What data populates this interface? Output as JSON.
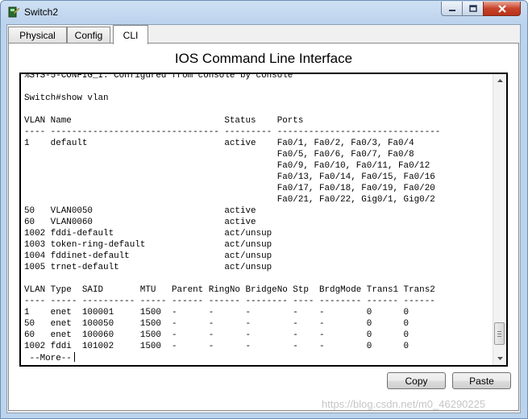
{
  "window": {
    "title": "Switch2"
  },
  "tabs": [
    {
      "label": "Physical"
    },
    {
      "label": "Config"
    },
    {
      "label": "CLI"
    }
  ],
  "panel": {
    "title": "IOS Command Line Interface"
  },
  "terminal": {
    "text": "%SYS-5-CONFIG_I: Configured from console by console\n\nSwitch#show vlan\n\nVLAN Name                             Status    Ports\n---- -------------------------------- --------- -------------------------------\n1    default                          active    Fa0/1, Fa0/2, Fa0/3, Fa0/4\n                                                Fa0/5, Fa0/6, Fa0/7, Fa0/8\n                                                Fa0/9, Fa0/10, Fa0/11, Fa0/12\n                                                Fa0/13, Fa0/14, Fa0/15, Fa0/16\n                                                Fa0/17, Fa0/18, Fa0/19, Fa0/20\n                                                Fa0/21, Fa0/22, Gig0/1, Gig0/2\n50   VLAN0050                         active    \n60   VLAN0060                         active    \n1002 fddi-default                     act/unsup \n1003 token-ring-default               act/unsup \n1004 fddinet-default                  act/unsup \n1005 trnet-default                    act/unsup \n\nVLAN Type  SAID       MTU   Parent RingNo BridgeNo Stp  BrdgMode Trans1 Trans2\n---- ----- ---------- ----- ------ ------ -------- ---- -------- ------ ------\n1    enet  100001     1500  -      -      -        -    -        0      0\n50   enet  100050     1500  -      -      -        -    -        0      0\n60   enet  100060     1500  -      -      -        -    -        0      0\n1002 fddi  101002     1500  -      -      -        -    -        0      0",
    "prompt": " --More--"
  },
  "buttons": {
    "copy": "Copy",
    "paste": "Paste"
  },
  "watermark": "https://blog.csdn.net/m0_46290225"
}
